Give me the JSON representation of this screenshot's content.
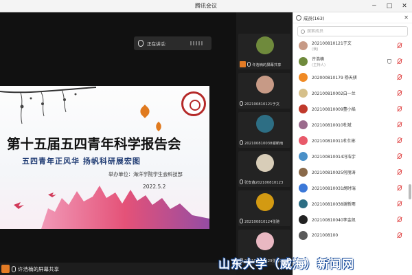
{
  "window": {
    "title": "腾讯会议"
  },
  "main": {
    "speaking_label": "正在讲话:",
    "slide": {
      "title": "第十五届五四青年科学报告会",
      "subtitle": "五四青年正风华  扬帆科研展宏图",
      "organizer": "举办单位：海洋学院学生会科技部",
      "date": "2022.5.2"
    },
    "share_label": "许浩楠的屏幕共享"
  },
  "gallery": [
    {
      "name": "许浩楠的屏幕共享",
      "color": "#6f8a3c",
      "sharing": true
    },
    {
      "name": "202100810121于文",
      "color": "#c79a86",
      "sharing": false
    },
    {
      "name": "202100810038谢新雨",
      "color": "#2d6e84",
      "sharing": false
    },
    {
      "name": "张安鑫202100810123",
      "color": "#d8cdb8",
      "sharing": false
    },
    {
      "name": "202100810124张驰",
      "color": "#d39a12",
      "sharing": false
    },
    {
      "name": "202100810129张馨云",
      "color": "#e9b8c2",
      "sharing": false
    }
  ],
  "panel": {
    "title": "成员(163)",
    "search_placeholder": "搜索成员",
    "members": [
      {
        "name": "202100810121于文",
        "role": "(我)",
        "color": "#c79a86",
        "host": false
      },
      {
        "name": "许浩楠",
        "role": "(主持人)",
        "color": "#6f8a3c",
        "host": true
      },
      {
        "name": "202000810179 杨天骐",
        "role": "",
        "color": "#f08a24",
        "host": false
      },
      {
        "name": "202100810002白一兰",
        "role": "",
        "color": "#d6c08a",
        "host": false
      },
      {
        "name": "202100810009董小焰",
        "role": "",
        "color": "#c0392b",
        "host": false
      },
      {
        "name": "202100810010杜斌",
        "role": "",
        "color": "#9b6a8c",
        "host": false
      },
      {
        "name": "202100810011杜仕彬",
        "role": "",
        "color": "#e85a6a",
        "host": false
      },
      {
        "name": "202100810014冯浩宇",
        "role": "",
        "color": "#4a90c8",
        "host": false
      },
      {
        "name": "202100810025何丽涛",
        "role": "",
        "color": "#8a6a4a",
        "host": false
      },
      {
        "name": "202100810031胡时瑞",
        "role": "",
        "color": "#3b78d8",
        "host": false
      },
      {
        "name": "202100810038谢新雨",
        "role": "",
        "color": "#2d6e84",
        "host": false
      },
      {
        "name": "202100810040李金凯",
        "role": "",
        "color": "#222222",
        "host": false
      },
      {
        "name": "2021008100",
        "role": "",
        "color": "#5a5a5a",
        "host": false
      }
    ]
  },
  "watermark": "山东大学（威海）新闻网"
}
